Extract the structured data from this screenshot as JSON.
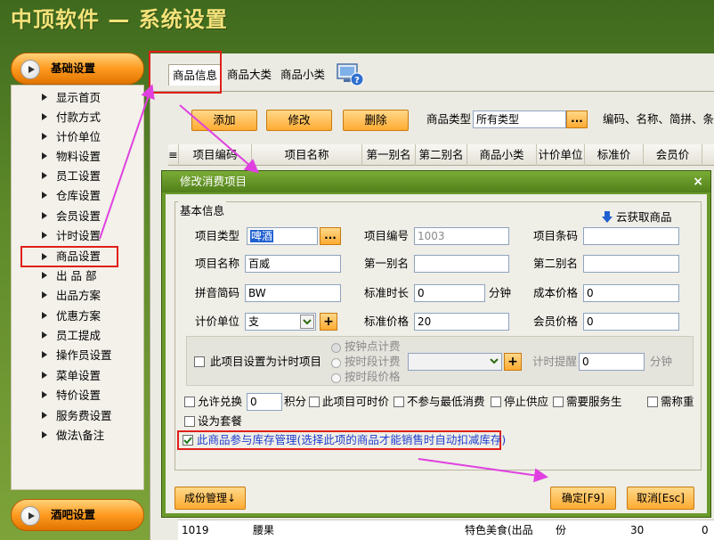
{
  "app": {
    "title": "中顶软件 — 系统设置"
  },
  "nav": {
    "basic_header": "基础设置",
    "bar_header": "酒吧设置",
    "items": [
      "显示首页",
      "付款方式",
      "计价单位",
      "物料设置",
      "员工设置",
      "仓库设置",
      "会员设置",
      "计时设置",
      "商品设置",
      "出 品 部",
      "出品方案",
      "优惠方案",
      "员工提成",
      "操作员设置",
      "菜单设置",
      "特价设置",
      "服务费设置",
      "做法\\备注"
    ]
  },
  "tabs": [
    "商品信息",
    "商品大类",
    "商品小类"
  ],
  "toolbar": {
    "add": "添加",
    "edit": "修改",
    "delete": "删除",
    "type_label": "商品类型",
    "type_value": "所有类型",
    "dots": "...",
    "search_hint": "编码、名称、简拼、条码"
  },
  "grid": {
    "columns": [
      "项目编码",
      "项目名称",
      "第一别名",
      "第二别名",
      "商品小类",
      "计价单位",
      "标准价",
      "会员价"
    ],
    "row": {
      "code": "1019",
      "name": "腰果",
      "category": "特色美食(出品",
      "unit": "份",
      "price": "30",
      "member_price": "0"
    }
  },
  "dialog": {
    "title": "修改消费项目",
    "close": "×",
    "group": "基本信息",
    "cloud": "云获取商品",
    "fields": {
      "type_label": "项目类型",
      "type_value": "啤酒",
      "code_label": "项目编号",
      "code_value": "1003",
      "barcode_label": "项目条码",
      "barcode_value": "",
      "name_label": "项目名称",
      "name_value": "百威",
      "alias1_label": "第一别名",
      "alias1_value": "",
      "alias2_label": "第二别名",
      "alias2_value": "",
      "pinyin_label": "拼音简码",
      "pinyin_value": "BW",
      "duration_label": "标准时长",
      "duration_value": "0",
      "duration_unit": "分钟",
      "cost_label": "成本价格",
      "cost_value": "0",
      "unit_label": "计价单位",
      "unit_value": "支",
      "std_price_label": "标准价格",
      "std_price_value": "20",
      "member_price_label": "会员价格",
      "member_price_value": "0"
    },
    "timer": {
      "checkbox": "此项目设置为计时项目",
      "radio1": "按钟点计费",
      "radio2": "按时段计费",
      "radio3": "按时段价格",
      "remind_label": "计时提醒",
      "remind_value": "0",
      "remind_unit": "分钟"
    },
    "options": {
      "exchange": "允许兑换",
      "exchange_value": "0",
      "points": "积分",
      "timed_price": "此项目可时价",
      "no_min": "不参与最低消费",
      "stop_supply": "停止供应",
      "need_waiter": "需要服务生",
      "need_weigh": "需称重",
      "set_meal": "设为套餐",
      "inventory": "此商品参与库存管理(选择此项的商品才能销售时自动扣减库存)"
    },
    "buttons": {
      "component": "成份管理↓",
      "ok": "确定[F9]",
      "cancel": "取消[Esc]"
    }
  },
  "colors": {
    "accent": "#ff9a1f",
    "highlight": "#e0201a",
    "annotation": "#e040e0",
    "title_bg": "#517f1a"
  }
}
